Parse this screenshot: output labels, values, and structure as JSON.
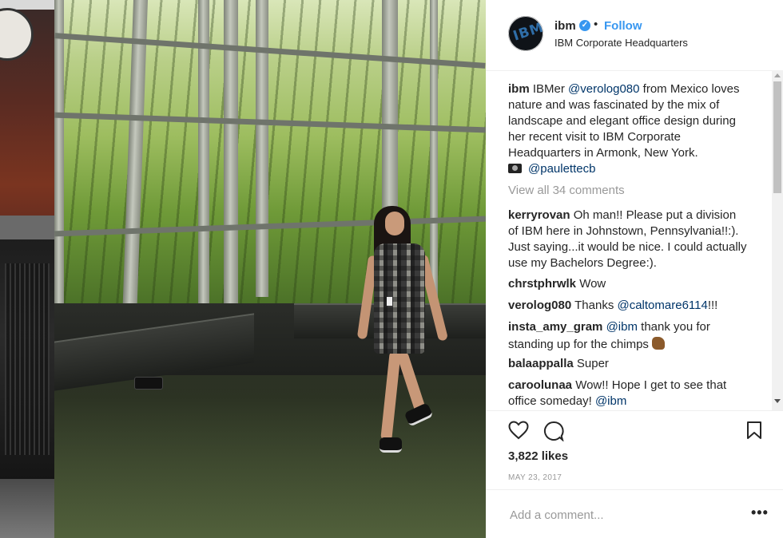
{
  "post": {
    "username": "ibm",
    "verified": true,
    "separator": "•",
    "follow_label": "Follow",
    "location": "IBM Corporate Headquarters",
    "caption": {
      "user": "ibm",
      "text_before": "IBMer ",
      "mention1": "@verolog080",
      "text_after": " from Mexico loves nature and was fascinated by the mix of landscape and elegant office design during her recent visit to IBM Corporate Headquarters in Armonk, New York.",
      "photo_credit_icon": "camera-icon",
      "mention2": "@paulettecb"
    },
    "view_all_comments": "View all 34 comments",
    "comments": [
      {
        "user": "kerryrovan",
        "text": "Oh man!! Please put a division of IBM here in Johnstown, Pennsylvania!!:). Just saying...it would be nice. I could actually use my Bachelors Degree:)."
      },
      {
        "user": "chrstphrwlk",
        "text": "Wow"
      },
      {
        "user": "verolog080",
        "text": "Thanks ",
        "mention": "@caltomare6114",
        "text_after": "!!!"
      },
      {
        "user": "insta_amy_gram",
        "mention": "@ibm",
        "text": " thank you for standing up for the chimps ",
        "emoji": "chipmunk-emoji"
      },
      {
        "user": "balaappalla",
        "text": "Super"
      },
      {
        "user": "caroolunaa",
        "text": "Wow!! Hope I get to see that office someday! ",
        "mention": "@ibm"
      }
    ],
    "likes": "3,822 likes",
    "date": "MAY 23, 2017",
    "add_comment_placeholder": "Add a comment...",
    "more_label": "•••"
  },
  "colors": {
    "link": "#3897f0",
    "mention": "#003569",
    "muted": "#999999",
    "text": "#262626",
    "border": "#efefef"
  },
  "icons": [
    "heart-icon",
    "comment-icon",
    "bookmark-icon",
    "verified-badge-icon",
    "camera-icon",
    "chipmunk-emoji"
  ]
}
